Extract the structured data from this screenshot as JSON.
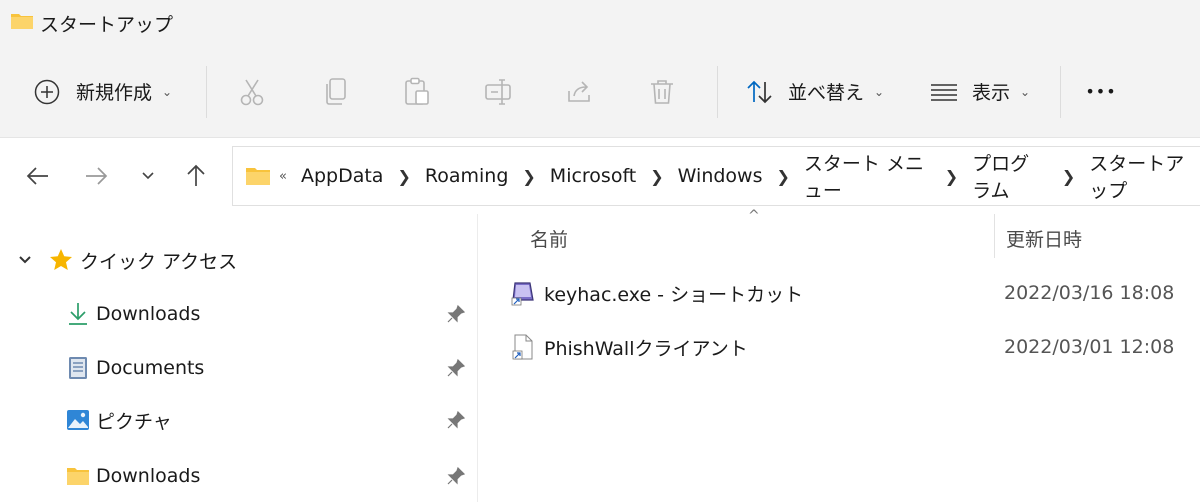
{
  "window": {
    "title": "スタートアップ"
  },
  "toolbar": {
    "new_label": "新規作成",
    "sort_label": "並べ替え",
    "view_label": "表示",
    "more_label": "•••"
  },
  "address": {
    "overflow": "«",
    "crumbs": [
      "AppData",
      "Roaming",
      "Microsoft",
      "Windows",
      "スタート メニュー",
      "プログラム",
      "スタートアップ"
    ]
  },
  "sidebar": {
    "quick_access_label": "クイック アクセス",
    "items": [
      {
        "label": "Downloads",
        "icon": "download-arrow-icon"
      },
      {
        "label": "Documents",
        "icon": "documents-icon"
      },
      {
        "label": "ピクチャ",
        "icon": "pictures-icon"
      },
      {
        "label": "Downloads",
        "icon": "folder-icon"
      }
    ]
  },
  "columns": {
    "name": "名前",
    "date": "更新日時",
    "sort_indicator": "^"
  },
  "files": [
    {
      "name": "keyhac.exe - ショートカット",
      "date": "2022/03/16 18:08",
      "icon": "keyhac-shortcut-icon"
    },
    {
      "name": "PhishWallクライアント",
      "date": "2022/03/01 12:08",
      "icon": "shortcut-file-icon"
    }
  ],
  "colors": {
    "accent": "#0067c0",
    "folder": "#f8c33c",
    "star": "#f7b500",
    "toolbar_bg": "#f3f3f3"
  }
}
